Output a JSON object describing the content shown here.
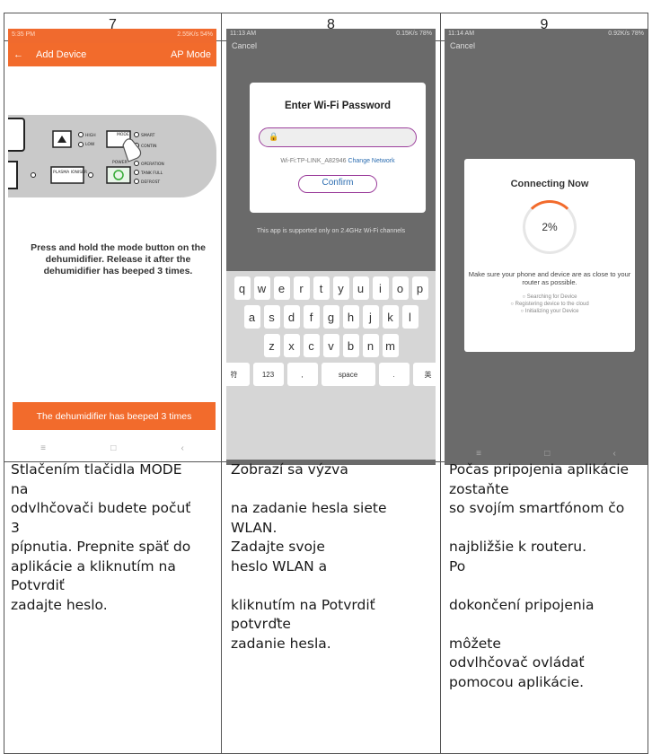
{
  "columns": [
    {
      "number": "7",
      "screen": {
        "status_time": "5:35 PM",
        "status_net": "2.55K/s",
        "status_batt": "54%",
        "back_icon": "arrow-left-icon",
        "title": "Add Device",
        "mode_link": "AP Mode",
        "panel_labels": [
          "HIGH",
          "LOW",
          "MODE",
          "SMART",
          "CONTIN",
          "PLASMA IONISER",
          "POWER",
          "OPERATION",
          "TANK FULL",
          "DEFROST"
        ],
        "instruction": "Press and hold the mode  button on the dehumidifier. Release it after the dehumidifier has beeped 3 times.",
        "button": "The dehumidifier has beeped 3 times"
      },
      "caption": [
        "Stlačením tlačidla MODE",
        "na",
        "odvlhčovači budete počuť",
        "3",
        "pípnutia. Prepnite späť do",
        "aplikácie a kliknutím na",
        "Potvrdiť",
        "zadajte heslo."
      ]
    },
    {
      "number": "8",
      "screen": {
        "status_time": "11:13 AM",
        "status_net": "0.15K/s",
        "status_batt": "78%",
        "cancel": "Cancel",
        "dialog_title": "Enter Wi-Fi Password",
        "wifi_label": "Wi-Fi:TP-LINK_A82946",
        "change_network": "Change Network",
        "confirm": "Confirm",
        "note": "This app is supported only on 2.4GHz Wi-Fi channels",
        "keys_row1": [
          "q",
          "w",
          "e",
          "r",
          "t",
          "y",
          "u",
          "i",
          "o",
          "p"
        ],
        "keys_row2": [
          "a",
          "s",
          "d",
          "f",
          "g",
          "h",
          "j",
          "k",
          "l"
        ],
        "keys_row3": [
          "z",
          "x",
          "c",
          "v",
          "b",
          "n",
          "m"
        ],
        "keys_bottom": [
          "符",
          "123",
          ",",
          "space",
          ".",
          "英"
        ]
      },
      "caption": [
        "Zobrazí sa výzva",
        "",
        "na zadanie hesla siete",
        "WLAN.",
        " Zadajte svoje",
        "heslo WLAN a",
        "",
        "kliknutím na Potvrdiť",
        "potvrďte",
        "zadanie hesla."
      ]
    },
    {
      "number": "9",
      "screen": {
        "status_time": "11:14 AM",
        "status_net": "0.92K/s",
        "status_batt": "78%",
        "cancel": "Cancel",
        "card_title": "Connecting Now",
        "progress_percent": "2%",
        "progress_value": 0.02,
        "message": "Make sure your phone and device are as close to your router as possible.",
        "steps": [
          "Searching for Device",
          "Registering device to the cloud",
          "Initializing your Device"
        ]
      },
      "caption": [
        "Počas pripojenia aplikácie",
        "zostaňte",
        "so svojím smartfónom čo",
        "",
        "najbližšie k routeru.",
        " Po",
        "",
        "dokončení pripojenia",
        "",
        "môžete",
        "odvlhčovač ovládať",
        "pomocou aplikácie."
      ]
    }
  ],
  "colors": {
    "accent": "#f26b2c",
    "highlight": "#9c3f9c",
    "link": "#2b6cb0"
  }
}
